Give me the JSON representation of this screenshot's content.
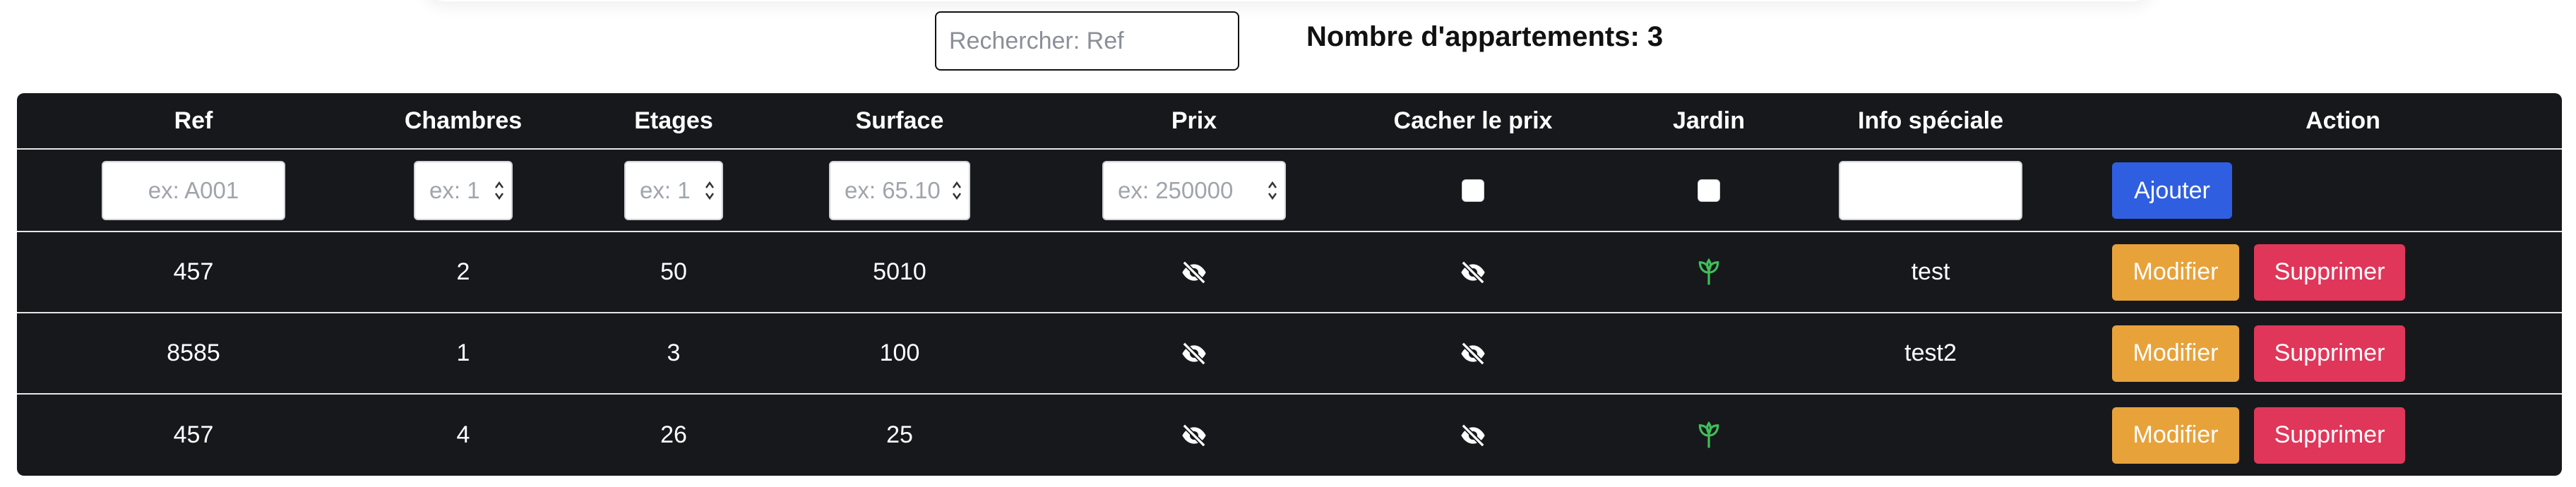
{
  "search": {
    "placeholder": "Rechercher: Ref"
  },
  "count_text": "Nombre d'appartements: 3",
  "table": {
    "headers": [
      "Ref",
      "Chambres",
      "Etages",
      "Surface",
      "Prix",
      "Cacher le prix",
      "Jardin",
      "Info spéciale",
      "Action"
    ],
    "new_row": {
      "ref_placeholder": "ex: A001",
      "chambres_placeholder": "ex: 1",
      "etages_placeholder": "ex: 1",
      "surface_placeholder": "ex: 65.10",
      "prix_placeholder": "ex: 250000",
      "add_label": "Ajouter"
    },
    "rows": [
      {
        "ref": "457",
        "chambres": "2",
        "etages": "50",
        "surface": "5010",
        "prix_icon": "eye-slash-icon",
        "cacher_icon": "eye-slash-icon",
        "jardin": true,
        "info": "test"
      },
      {
        "ref": "8585",
        "chambres": "1",
        "etages": "3",
        "surface": "100",
        "prix_icon": "eye-slash-icon",
        "cacher_icon": "eye-slash-icon",
        "jardin": false,
        "info": "test2"
      },
      {
        "ref": "457",
        "chambres": "4",
        "etages": "26",
        "surface": "25",
        "prix_icon": "eye-slash-icon",
        "cacher_icon": "eye-slash-icon",
        "jardin": true,
        "info": ""
      }
    ],
    "modify_label": "Modifier",
    "delete_label": "Supprimer"
  },
  "colors": {
    "table_bg": "#17181c",
    "add_button": "#2f5fe0",
    "modify_button": "#e8a23a",
    "delete_button": "#e0365a",
    "garden_icon": "#3fbf5a"
  }
}
